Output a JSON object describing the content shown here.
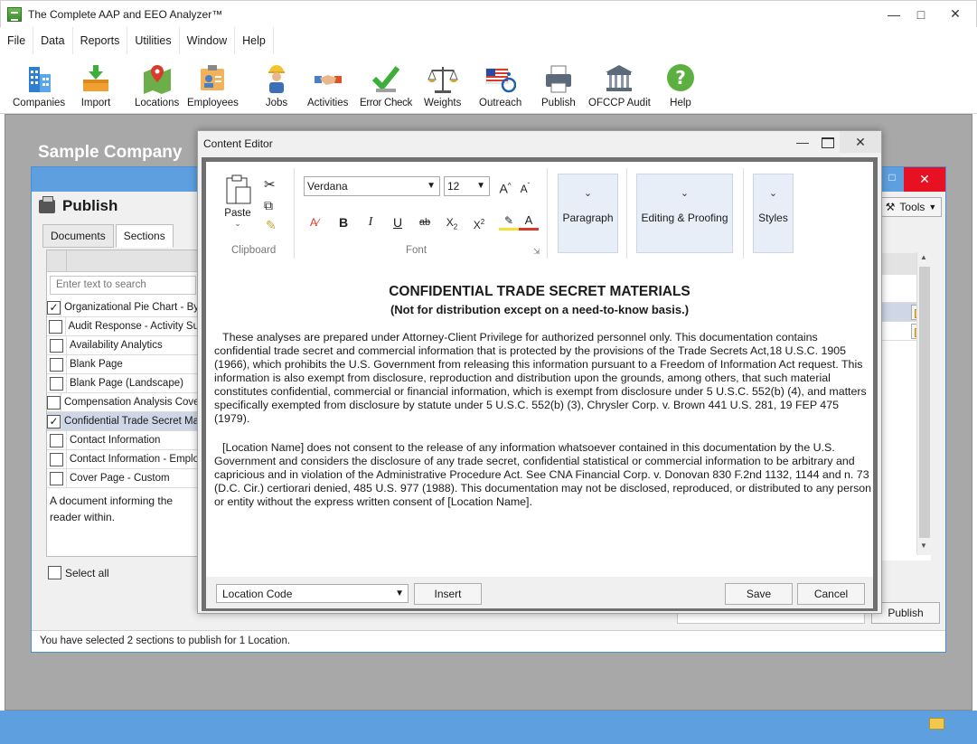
{
  "window": {
    "title": "The Complete AAP and EEO Analyzer™"
  },
  "menu": [
    "File",
    "Data",
    "Reports",
    "Utilities",
    "Window",
    "Help"
  ],
  "toolbar": [
    {
      "label": "Companies",
      "icon": "buildings-icon"
    },
    {
      "label": "Import",
      "icon": "import-icon"
    },
    {
      "label": "Locations",
      "icon": "map-pin-icon"
    },
    {
      "label": "Employees",
      "icon": "employee-badge-icon"
    },
    {
      "label": "Jobs",
      "icon": "worker-icon"
    },
    {
      "label": "Activities",
      "icon": "handshake-icon"
    },
    {
      "label": "Error Check",
      "icon": "checkmark-icon"
    },
    {
      "label": "Weights",
      "icon": "scales-icon"
    },
    {
      "label": "Outreach",
      "icon": "flag-accessibility-icon"
    },
    {
      "label": "Publish",
      "icon": "printer-icon"
    },
    {
      "label": "OFCCP Audit",
      "icon": "courthouse-icon"
    },
    {
      "label": "Help",
      "icon": "help-icon"
    }
  ],
  "workspace": {
    "company_title": "Sample Company"
  },
  "publish": {
    "title": "Publish",
    "tabs": [
      "Documents",
      "Sections"
    ],
    "search_placeholder": "Enter text to search",
    "sections": [
      {
        "label": "Organizational Pie Chart - By",
        "checked": true
      },
      {
        "label": "Audit Response - Activity Su",
        "checked": false
      },
      {
        "label": "Availability Analytics",
        "checked": false
      },
      {
        "label": "Blank Page",
        "checked": false
      },
      {
        "label": "Blank Page (Landscape)",
        "checked": false
      },
      {
        "label": "Compensation Analysis Cove",
        "checked": false
      },
      {
        "label": "Confidential Trade Secret Ma",
        "checked": true,
        "selected": true
      },
      {
        "label": "Contact Information",
        "checked": false
      },
      {
        "label": "Contact Information - Emplo",
        "checked": false
      },
      {
        "label": "Cover Page - Custom",
        "checked": false
      }
    ],
    "description": "A document informing the reader within.",
    "select_all": "Select all",
    "tools": "Tools",
    "publish_button": "Publish",
    "status": "You have selected 2 sections to publish for 1 Location."
  },
  "editor": {
    "title": "Content Editor",
    "ribbon": {
      "paste": "Paste",
      "clipboard": "Clipboard",
      "font_name": "Verdana",
      "font_size": "12",
      "font_group": "Font",
      "paragraph": "Paragraph",
      "editing": "Editing & Proofing",
      "styles": "Styles"
    },
    "doc": {
      "heading": "CONFIDENTIAL TRADE SECRET MATERIALS",
      "subheading": "(Not for distribution except on a need-to-know basis.)",
      "para1": "These analyses are prepared under Attorney-Client Privilege for authorized personnel only. This documentation contains confidential trade secret and commercial information that is protected by the provisions of the Trade Secrets Act,18 U.S.C. 1905 (1966), which prohibits the U.S. Government from releasing this information pursuant to a Freedom of Information Act request. This information is also exempt from disclosure, reproduction and distribution upon the grounds, among others, that such material constitutes confidential, commercial or financial information, which is exempt from disclosure under 5 U.S.C. 552(b) (4), and matters specifically exempted from disclosure by statute under 5 U.S.C. 552(b) (3), Chrysler Corp. v. Brown 441 U.S. 281, 19 FEP 475 (1979).",
      "para2": "[Location Name] does not consent to the release of any information whatsoever contained in this documentation by the U.S. Government and considers the disclosure of any trade secret, confidential statistical or commercial information to be arbitrary and capricious and in violation of the Administrative Procedure Act. See CNA Financial Corp. v. Donovan 830 F.2nd 1132, 1144 and n. 73 (D.C. Cir.) certiorari denied, 485 U.S. 977 (1988). This documentation may not be disclosed, reproduced, or distributed to any person or entity without the express written consent of [Location Name]."
    },
    "field_select": "Location Code",
    "insert": "Insert",
    "save": "Save",
    "cancel": "Cancel"
  },
  "colors": {
    "accent": "#5e9fe0",
    "close": "#e81123",
    "workspace": "#a8a8a8"
  }
}
